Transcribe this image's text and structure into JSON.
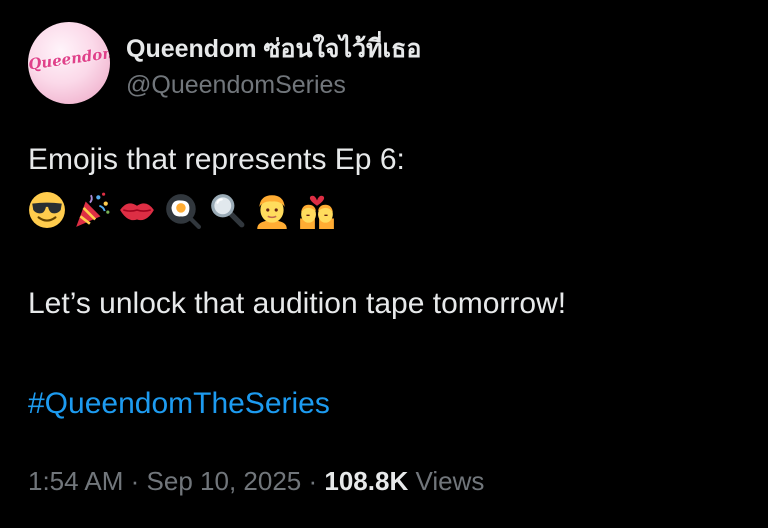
{
  "tweet": {
    "author": {
      "display_name": "Queendom ซ่อนใจไว้ที่เธอ",
      "handle": "@QueendomSeries",
      "avatar_logo_text": "Queendom"
    },
    "text_line1": "Emojis that represents Ep 6:",
    "emojis": [
      {
        "name": "smiling-face-with-sunglasses",
        "char": "😎"
      },
      {
        "name": "party-popper",
        "char": "🎉"
      },
      {
        "name": "kiss-mark",
        "char": "💋"
      },
      {
        "name": "cooking-egg",
        "char": "🍳"
      },
      {
        "name": "magnifying-glass",
        "char": "🔍"
      },
      {
        "name": "person-blond-hair",
        "char": "👱"
      },
      {
        "name": "kiss-couple",
        "char": "💏"
      }
    ],
    "text_line2": "Let’s unlock that audition tape tomorrow!",
    "hashtag": "#QueendomTheSeries",
    "meta": {
      "time": "1:54 AM",
      "separator": "·",
      "date": "Sep 10, 2025",
      "views_count": "108.8K",
      "views_label": "Views"
    }
  },
  "colors": {
    "background": "#000000",
    "primary_text": "#e7e9ea",
    "secondary_text": "#71767b",
    "link": "#1d9bf0",
    "avatar_pink": "#f1b6d0"
  }
}
